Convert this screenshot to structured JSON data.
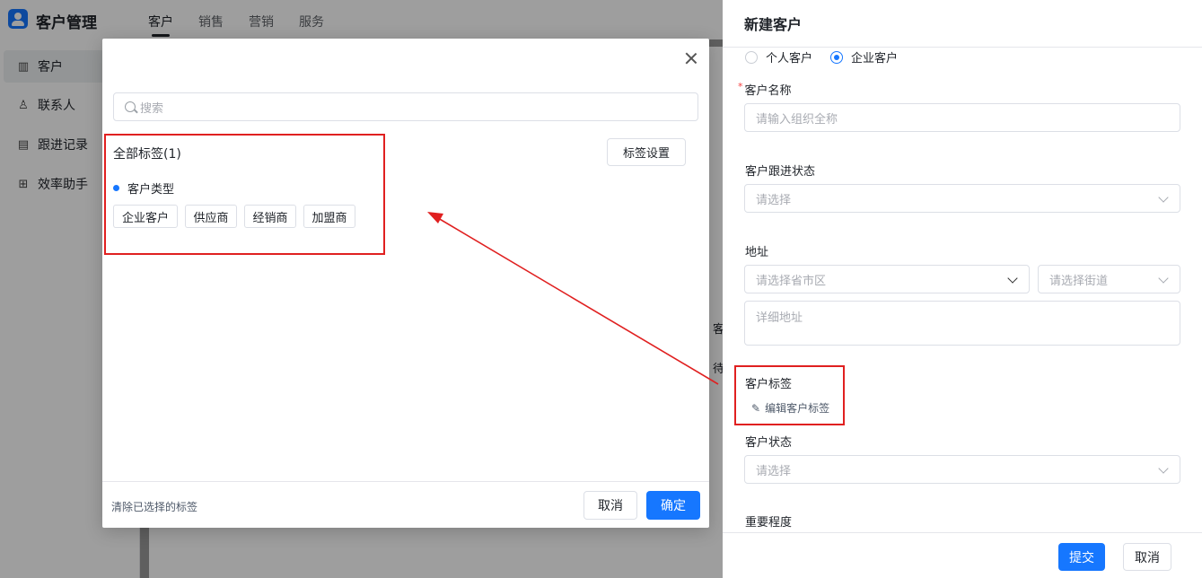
{
  "app": {
    "title": "客户管理"
  },
  "nav": {
    "tabs": [
      {
        "label": "客户"
      },
      {
        "label": "销售"
      },
      {
        "label": "营销"
      },
      {
        "label": "服务"
      }
    ]
  },
  "sidebar": {
    "items": [
      {
        "label": "客户"
      },
      {
        "label": "联系人"
      },
      {
        "label": "跟进记录"
      },
      {
        "label": "效率助手"
      }
    ]
  },
  "background": {
    "partial_texts": [
      "客",
      "待"
    ]
  },
  "drawer": {
    "title": "新建客户",
    "radio_personal": "个人客户",
    "radio_enterprise": "企业客户",
    "name_label": "客户名称",
    "required_mark": "*",
    "name_placeholder": "请输入组织全称",
    "follow_label": "客户跟进状态",
    "follow_placeholder": "请选择",
    "address_label": "地址",
    "province_placeholder": "请选择省市区",
    "street_placeholder": "请选择街道",
    "detail_placeholder": "详细地址",
    "tag_label": "客户标签",
    "edit_tag_label": "编辑客户标签",
    "status_label": "客户状态",
    "status_placeholder": "请选择",
    "importance_label": "重要程度",
    "submit_label": "提交",
    "cancel_label": "取消"
  },
  "modal": {
    "search_placeholder": "搜索",
    "all_tags_label": "全部标签(1)",
    "tag_settings_label": "标签设置",
    "group_title": "客户类型",
    "tags": [
      "企业客户",
      "供应商",
      "经销商",
      "加盟商"
    ],
    "clear_label": "清除已选择的标签",
    "cancel_label": "取消",
    "ok_label": "确定"
  },
  "colors": {
    "primary": "#1677ff",
    "annotation_red": "#e02020"
  }
}
